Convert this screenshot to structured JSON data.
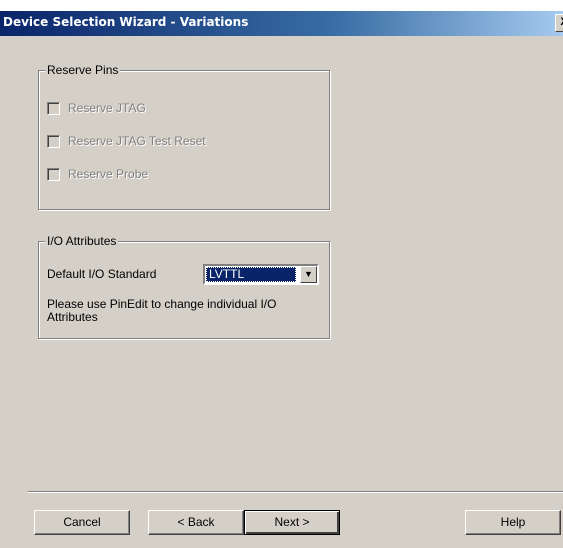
{
  "window": {
    "title": "Device Selection Wizard - Variations",
    "close_label": "X"
  },
  "reserve_pins": {
    "legend": "Reserve Pins",
    "options": [
      {
        "label": "Reserve JTAG",
        "checked": false,
        "enabled": false
      },
      {
        "label": "Reserve JTAG Test Reset",
        "checked": false,
        "enabled": false
      },
      {
        "label": "Reserve Probe",
        "checked": false,
        "enabled": false
      }
    ]
  },
  "io_attributes": {
    "legend": "I/O Attributes",
    "default_standard_label": "Default I/O Standard",
    "default_standard_value": "LVTTL",
    "note": "Please use PinEdit to change individual I/O Attributes"
  },
  "buttons": {
    "cancel": "Cancel",
    "back": "< Back",
    "next": "Next >",
    "help": "Help"
  }
}
